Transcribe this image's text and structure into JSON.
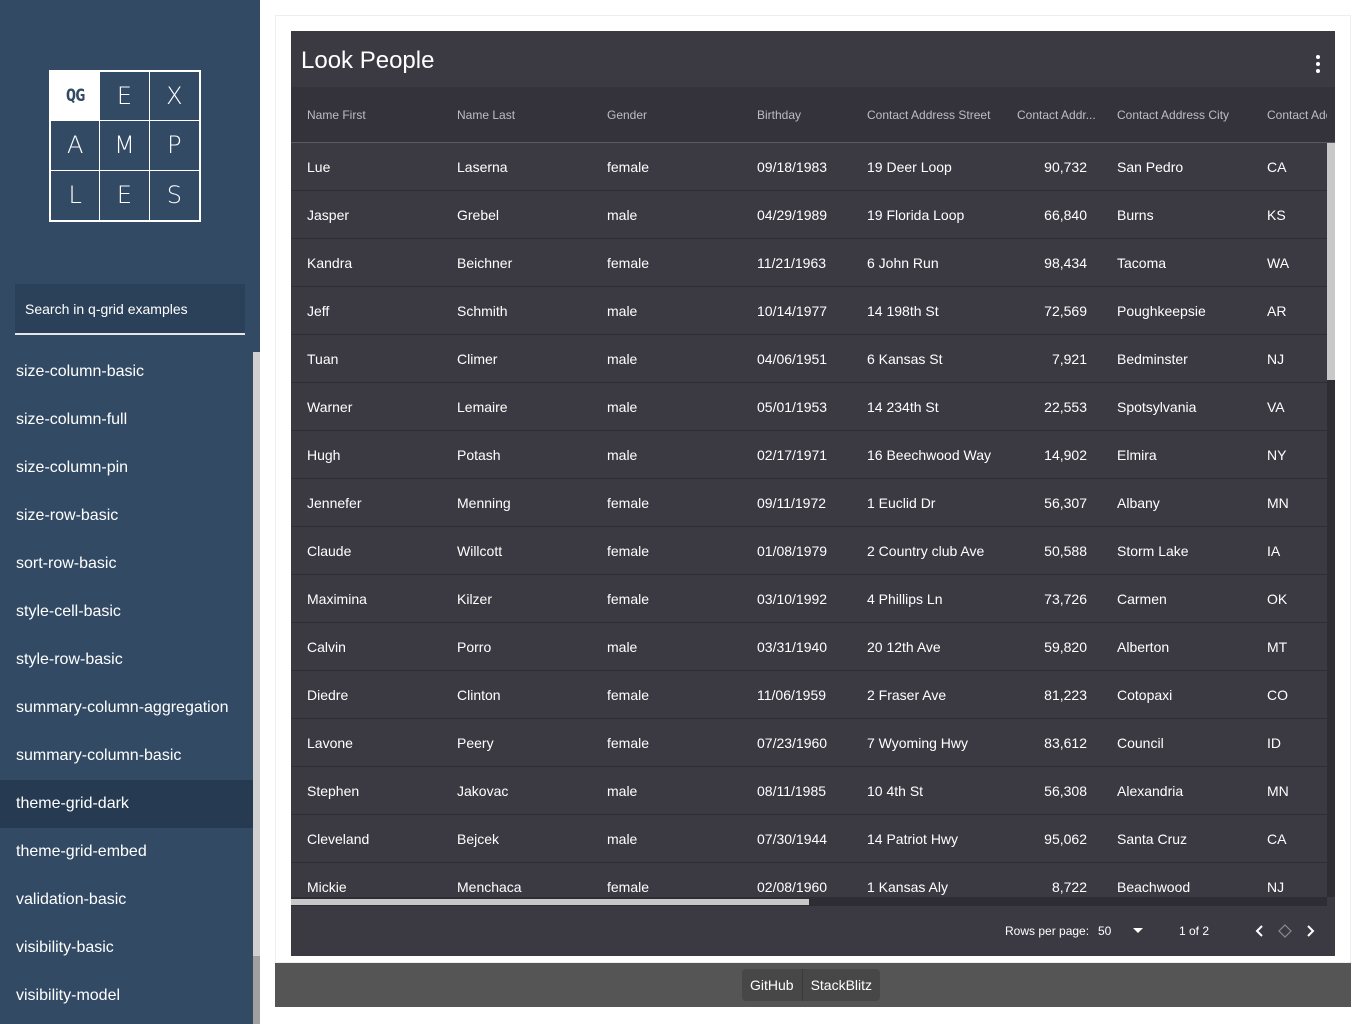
{
  "sidebar": {
    "logo": {
      "cells": [
        "QG",
        "E",
        "X",
        "A",
        "M",
        "P",
        "L",
        "E",
        "S"
      ]
    },
    "search": {
      "placeholder": "Search in q-grid examples"
    },
    "items": [
      {
        "label": "size-column-basic"
      },
      {
        "label": "size-column-full"
      },
      {
        "label": "size-column-pin"
      },
      {
        "label": "size-row-basic"
      },
      {
        "label": "sort-row-basic"
      },
      {
        "label": "style-cell-basic"
      },
      {
        "label": "style-row-basic"
      },
      {
        "label": "summary-column-aggregation"
      },
      {
        "label": "summary-column-basic"
      },
      {
        "label": "theme-grid-dark",
        "active": true
      },
      {
        "label": "theme-grid-embed"
      },
      {
        "label": "validation-basic"
      },
      {
        "label": "visibility-basic"
      },
      {
        "label": "visibility-model"
      }
    ]
  },
  "grid": {
    "title": "Look People",
    "columns": [
      "Name First",
      "Name Last",
      "Gender",
      "Birthday",
      "Contact Address Street",
      "Contact Addr...",
      "Contact Address City",
      "Contact Addr"
    ],
    "rows": [
      [
        "Lue",
        "Laserna",
        "female",
        "09/18/1983",
        "19 Deer Loop",
        "90,732",
        "San Pedro",
        "CA"
      ],
      [
        "Jasper",
        "Grebel",
        "male",
        "04/29/1989",
        "19 Florida Loop",
        "66,840",
        "Burns",
        "KS"
      ],
      [
        "Kandra",
        "Beichner",
        "female",
        "11/21/1963",
        "6 John Run",
        "98,434",
        "Tacoma",
        "WA"
      ],
      [
        "Jeff",
        "Schmith",
        "male",
        "10/14/1977",
        "14 198th St",
        "72,569",
        "Poughkeepsie",
        "AR"
      ],
      [
        "Tuan",
        "Climer",
        "male",
        "04/06/1951",
        "6 Kansas St",
        "7,921",
        "Bedminster",
        "NJ"
      ],
      [
        "Warner",
        "Lemaire",
        "male",
        "05/01/1953",
        "14 234th St",
        "22,553",
        "Spotsylvania",
        "VA"
      ],
      [
        "Hugh",
        "Potash",
        "male",
        "02/17/1971",
        "16 Beechwood Way",
        "14,902",
        "Elmira",
        "NY"
      ],
      [
        "Jennefer",
        "Menning",
        "female",
        "09/11/1972",
        "1 Euclid Dr",
        "56,307",
        "Albany",
        "MN"
      ],
      [
        "Claude",
        "Willcott",
        "female",
        "01/08/1979",
        "2 Country club Ave",
        "50,588",
        "Storm Lake",
        "IA"
      ],
      [
        "Maximina",
        "Kilzer",
        "female",
        "03/10/1992",
        "4 Phillips Ln",
        "73,726",
        "Carmen",
        "OK"
      ],
      [
        "Calvin",
        "Porro",
        "male",
        "03/31/1940",
        "20 12th Ave",
        "59,820",
        "Alberton",
        "MT"
      ],
      [
        "Diedre",
        "Clinton",
        "female",
        "11/06/1959",
        "2 Fraser Ave",
        "81,223",
        "Cotopaxi",
        "CO"
      ],
      [
        "Lavone",
        "Peery",
        "female",
        "07/23/1960",
        "7 Wyoming Hwy",
        "83,612",
        "Council",
        "ID"
      ],
      [
        "Stephen",
        "Jakovac",
        "male",
        "08/11/1985",
        "10 4th St",
        "56,308",
        "Alexandria",
        "MN"
      ],
      [
        "Cleveland",
        "Bejcek",
        "male",
        "07/30/1944",
        "14 Patriot Hwy",
        "95,062",
        "Santa Cruz",
        "CA"
      ],
      [
        "Mickie",
        "Menchaca",
        "female",
        "02/08/1960",
        "1 Kansas Aly",
        "8,722",
        "Beachwood",
        "NJ"
      ]
    ],
    "pager": {
      "rows_per_page_label": "Rows per page:",
      "page_size": "50",
      "page_info": "1 of 2"
    }
  },
  "footer": {
    "github_label": "GitHub",
    "stackblitz_label": "StackBlitz"
  }
}
